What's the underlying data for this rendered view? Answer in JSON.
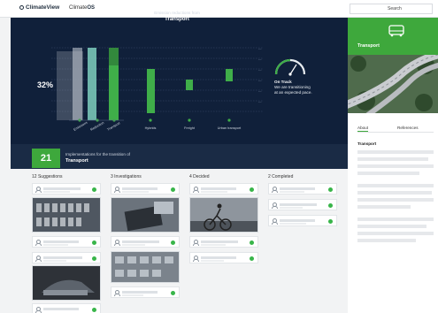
{
  "topbar": {
    "logo": "ClimateView",
    "nav_prefix": "Climate",
    "nav_suffix": "OS",
    "search_label": "Search"
  },
  "dashboard": {
    "subtitle": "Emission reductions from",
    "title": "Transport",
    "percent": "32%",
    "status_title": "On Track",
    "status_line1": "We are transitioning",
    "status_line2": "at an expected pace."
  },
  "chart_data": {
    "type": "bar",
    "title": "Transport",
    "subtitle": "Emission reductions from",
    "left_groups": [
      "Emissions",
      "Reduction",
      "Transport"
    ],
    "categories": [
      "Hybrids",
      "Freight",
      "Urban transport"
    ],
    "values": [
      28,
      14,
      10
    ],
    "progress_percent": 32,
    "colors": {
      "bar": "#3fae49",
      "background": "#10203a"
    }
  },
  "summary": {
    "count": "21",
    "subtitle": "Implementations for the transition of",
    "title": "Transport"
  },
  "board": {
    "columns": [
      {
        "label": "12 Suggestions"
      },
      {
        "label": "3 Investigations"
      },
      {
        "label": "4 Decided"
      },
      {
        "label": "2 Completed"
      }
    ]
  },
  "details": {
    "title": "Transport",
    "tabs": [
      "About",
      "References"
    ],
    "section": "Transport"
  }
}
